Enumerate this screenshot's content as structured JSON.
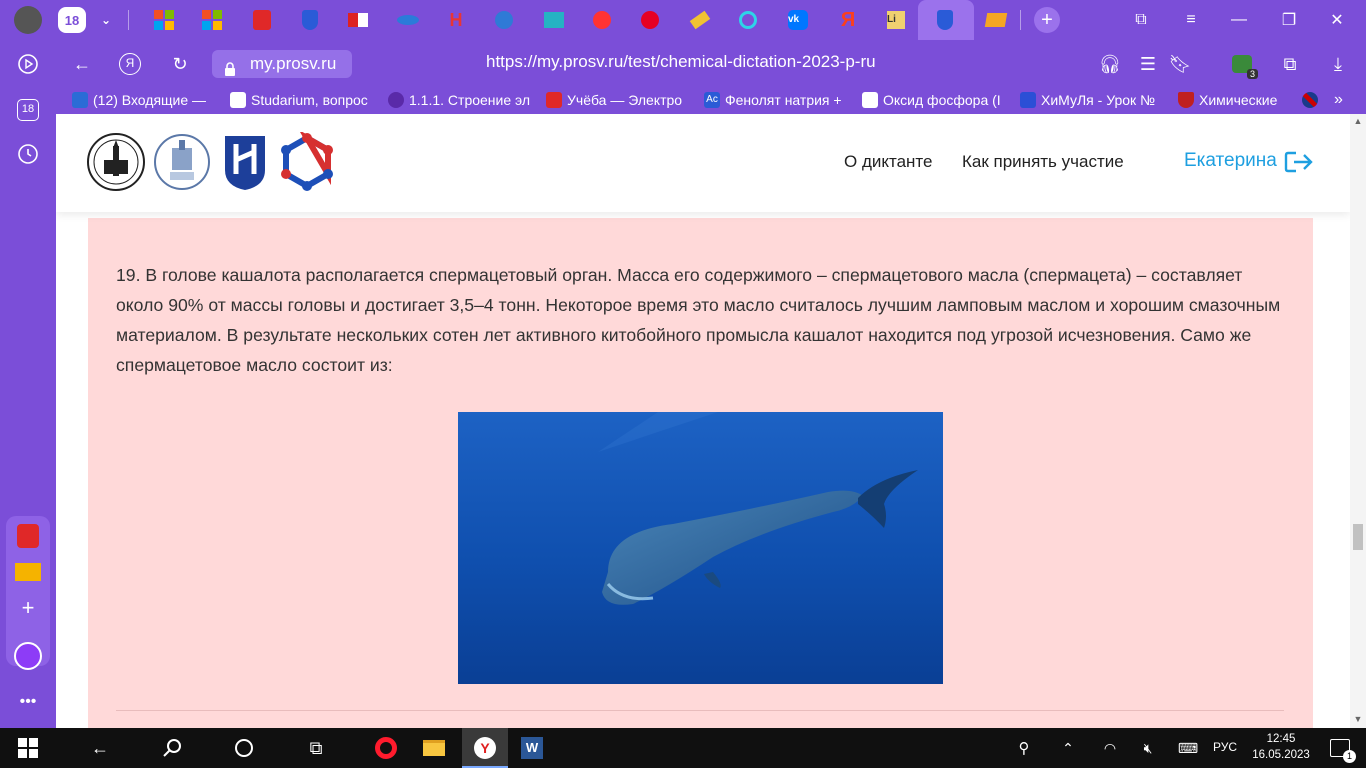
{
  "tabs": {
    "counter_badge": "18",
    "items": [
      "microsoft-logo",
      "microsoft-logo",
      "notes-doc",
      "prosv-shield",
      "flag-tab",
      "bird-tab",
      "n-tab",
      "lion-tab",
      "book-tab",
      "youtube-tab",
      "pinterest-tab",
      "telescope-tab",
      "reload-tab",
      "vk-tab",
      "yandex-tab",
      "li-tab",
      "prosv-shield-active",
      "mail-tab"
    ]
  },
  "sidebar": {
    "counter_badge": "18"
  },
  "address_bar": {
    "domain": "my.prosv.ru",
    "url": "https://my.prosv.ru/test/chemical-dictation-2023-p-ru",
    "extensions_badge": "3"
  },
  "bookmarks": [
    {
      "label": "(12) Входящие — ",
      "icon": "mail-icon"
    },
    {
      "label": "Studarium, вопрос",
      "icon": "studarium-icon"
    },
    {
      "label": "1.1.1. Строение эл",
      "icon": "molecule-icon"
    },
    {
      "label": "Учёба — Электро",
      "icon": "doc-icon"
    },
    {
      "label": "Фенолят натрия +",
      "icon": "ac-icon"
    },
    {
      "label": "Оксид фосфора (I",
      "icon": "dots-icon"
    },
    {
      "label": "ХиМуЛя - Урок №",
      "icon": "window-icon"
    },
    {
      "label": "Химические",
      "icon": "flask-icon"
    }
  ],
  "site": {
    "nav": {
      "about": "О диктанте",
      "howto": "Как принять участие"
    },
    "user_name": "Екатерина"
  },
  "question": {
    "text": "19. В голове кашалота располагается спермацетовый орган. Масса его содержимого – спермацетового масла (спермацета) – составляет около 90% от массы головы и достигает 3,5–4 тонн. Некоторое время это масло считалось лучшим ламповым маслом и хорошим смазочным материалом. В результате нескольких сотен лет активного китобойного промысла кашалот находится под угрозой исчезновения. Само же спермацетовое масло состоит из:"
  },
  "taskbar": {
    "language": "РУС",
    "time": "12:45",
    "date": "16.05.2023",
    "notification_count": "1"
  },
  "colors": {
    "browser_purple": "#7b4ed8",
    "card_pink": "#ffd9d9",
    "link_blue": "#1e9fe0"
  }
}
